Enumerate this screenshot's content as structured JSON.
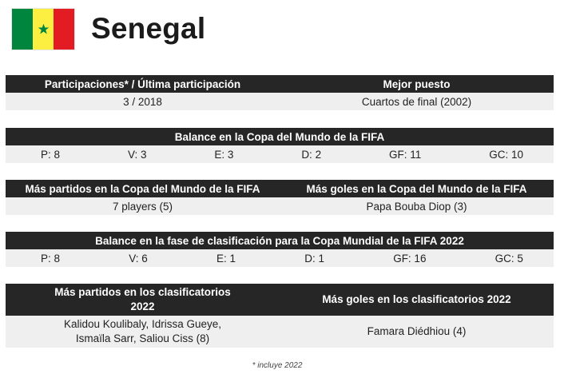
{
  "country": {
    "name": "Senegal"
  },
  "participation": {
    "header_left": "Participaciones* / Última participación",
    "header_right": "Mejor puesto",
    "value_left": "3 / 2018",
    "value_right": "Cuartos de final (2002)"
  },
  "world_cup_record": {
    "header": "Balance en la Copa del Mundo de la FIFA",
    "stats": [
      "P: 8",
      "V: 3",
      "E: 3",
      "D: 2",
      "GF: 11",
      "GC: 10"
    ]
  },
  "world_cup_leaders": {
    "header_left": "Más partidos en la Copa del Mundo de la FIFA",
    "header_right": "Más goles en la Copa del Mundo de la FIFA",
    "value_left": "7 players (5)",
    "value_right": "Papa Bouba Diop (3)"
  },
  "qualifying_record": {
    "header": "Balance en la fase de clasificación para la Copa Mundial de la FIFA 2022",
    "stats": [
      "P: 8",
      "V: 6",
      "E: 1",
      "D: 1",
      "GF: 16",
      "GC: 5"
    ]
  },
  "qualifying_leaders": {
    "header_left_line1": "Más partidos en los clasificatorios",
    "header_left_line2": "2022",
    "header_right": "Más goles en los clasificatorios 2022",
    "value_left_line1": "Kalidou Koulibaly, Idrissa Gueye,",
    "value_left_line2": "Ismaïla Sarr, Saliou Ciss (8)",
    "value_right": "Famara Diédhiou (4)"
  },
  "footnote": "* incluye 2022",
  "colors": {
    "header_bg": "#262626",
    "row_bg": "#efefef",
    "flag_green": "#00853f",
    "flag_yellow": "#fdef42",
    "flag_red": "#e31b23"
  }
}
